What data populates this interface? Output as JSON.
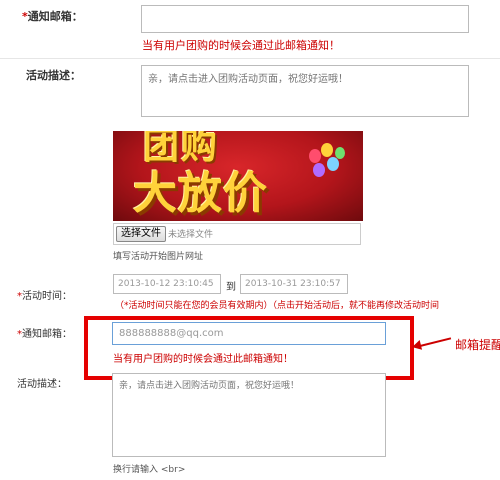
{
  "top_form": {
    "email_label": "通知邮箱：",
    "email_value": "",
    "email_hint": "当有用户团购的时候会通过此邮箱通知！",
    "desc_label": "活动描述：",
    "desc_placeholder": "亲，请点击进入团购活动页面，祝您好运哦！"
  },
  "banner": {
    "line1": "团购",
    "line2": "大放价"
  },
  "upload": {
    "choose_button": "选择文件",
    "status": "未选择文件",
    "hint": "填写活动开始图片网址"
  },
  "time": {
    "label": "活动时间：",
    "start": "2013-10-12 23:10:45",
    "separator": "到",
    "end": "2013-10-31 23:10:57",
    "note": "（*活动时间只能在您的会员有效期内）（点击开始活动后，就不能再修改活动时间"
  },
  "bottom_form": {
    "email_label": "通知邮箱：",
    "email_value": "888888888@qq.com",
    "email_hint": "当有用户团购的时候会通过此邮箱通知！",
    "desc_label": "活动描述：",
    "desc_placeholder": "亲，请点击进入团购活动页面，祝您好运哦！",
    "desc_hint": "换行请输入 <br>"
  },
  "annotation": {
    "callout": "邮箱提醒",
    "highlight_color": "#e50000"
  },
  "colors": {
    "required_asterisk": "#cc0000",
    "hint_red": "#cc0000"
  }
}
